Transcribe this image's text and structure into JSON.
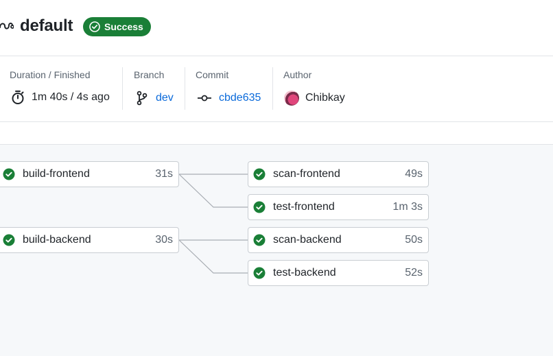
{
  "workflow": {
    "title": "default",
    "status": "Success"
  },
  "meta": {
    "duration_label": "Duration / Finished",
    "duration_value": "1m 40s / 4s ago",
    "branch_label": "Branch",
    "branch_value": "dev",
    "commit_label": "Commit",
    "commit_value": "cbde635",
    "author_label": "Author",
    "author_value": "Chibkay"
  },
  "jobs": {
    "build_frontend": {
      "name": "build-frontend",
      "duration": "31s"
    },
    "build_backend": {
      "name": "build-backend",
      "duration": "30s"
    },
    "scan_frontend": {
      "name": "scan-frontend",
      "duration": "49s"
    },
    "test_frontend": {
      "name": "test-frontend",
      "duration": "1m 3s"
    },
    "scan_backend": {
      "name": "scan-backend",
      "duration": "50s"
    },
    "test_backend": {
      "name": "test-backend",
      "duration": "52s"
    }
  },
  "colors": {
    "success": "#1a7f37",
    "link": "#0969da",
    "graph_bg": "#f6f8fa"
  },
  "icons": {
    "workflow": "workflow-icon",
    "status": "check-circle-icon",
    "duration": "stopwatch-icon",
    "branch": "git-branch-icon",
    "commit": "git-commit-icon",
    "author": "avatar"
  }
}
